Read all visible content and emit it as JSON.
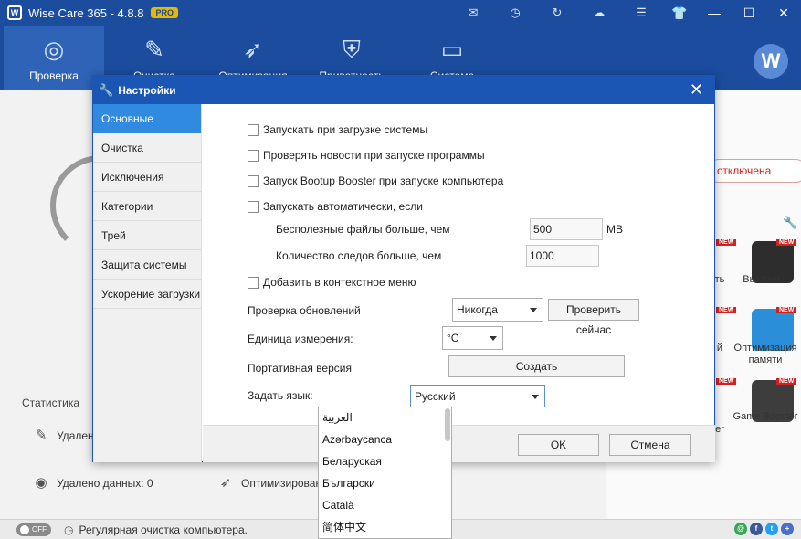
{
  "app": {
    "title": "Wise Care 365 - 4.8.8",
    "badge": "PRO",
    "nav": [
      {
        "label": "Проверка",
        "icon": "radar-icon"
      },
      {
        "label": "Очистка",
        "icon": "broom-icon"
      },
      {
        "label": "Оптимизация",
        "icon": "rocket-icon"
      },
      {
        "label": "Приватность",
        "icon": "shield-icon"
      },
      {
        "label": "Система",
        "icon": "monitor-icon"
      }
    ],
    "avatar_letter": "W"
  },
  "background": {
    "status_off": "отключена",
    "stats_title": "Статистика",
    "stat_deleted": "Удален",
    "stat_data_deleted": "Удалено данных: 0",
    "stat_optimized": "Оптимизирован",
    "tiles": [
      {
        "label": "Выключ...",
        "badge": "NEW"
      },
      {
        "label": "Оптимизация памяти",
        "badge": "NEW"
      },
      {
        "label": "Game Booster",
        "badge": "NEW"
      }
    ],
    "tile_partial_labels": [
      "ть",
      "й",
      "er"
    ]
  },
  "statusbar": {
    "toggle": "OFF",
    "text": "Регулярная очистка компьютера."
  },
  "dialog": {
    "title": "Настройки",
    "sidebar": [
      {
        "label": "Основные",
        "active": true
      },
      {
        "label": "Очистка",
        "active": false
      },
      {
        "label": "Исключения",
        "active": false
      },
      {
        "label": "Категории",
        "active": false
      },
      {
        "label": "Трей",
        "active": false
      },
      {
        "label": "Защита системы",
        "active": false
      },
      {
        "label": "Ускорение загрузки",
        "active": false
      }
    ],
    "options": {
      "startup": "Запускать при загрузке системы",
      "check_news": "Проверять новости при запуске программы",
      "bootup_booster": "Запуск Bootup Booster при запуске компьютера",
      "auto_run": "Запускать автоматически, если",
      "useless_files_label": "Бесполезные файлы больше, чем",
      "useless_files_value": "500",
      "useless_files_unit": "MB",
      "traces_label": "Количество следов больше, чем",
      "traces_value": "1000",
      "context_menu": "Добавить в контекстное меню",
      "update_check_label": "Проверка обновлений",
      "update_check_value": "Никогда",
      "check_now": "Проверить сейчас",
      "unit_label": "Единица измерения:",
      "unit_value": "°C",
      "portable_label": "Портативная версия",
      "create": "Создать",
      "language_label": "Задать язык:",
      "language_value": "Русский"
    },
    "languages": [
      "العربية",
      "Azərbaycanca",
      "Беларуская",
      "Български",
      "Català",
      "简体中文"
    ],
    "ok": "OK",
    "cancel": "Отмена"
  },
  "colors": {
    "title_blue": "#1b4c9e",
    "dialog_blue": "#1b56b5",
    "active_item": "#2f8ae0",
    "off_red": "#d32020"
  }
}
